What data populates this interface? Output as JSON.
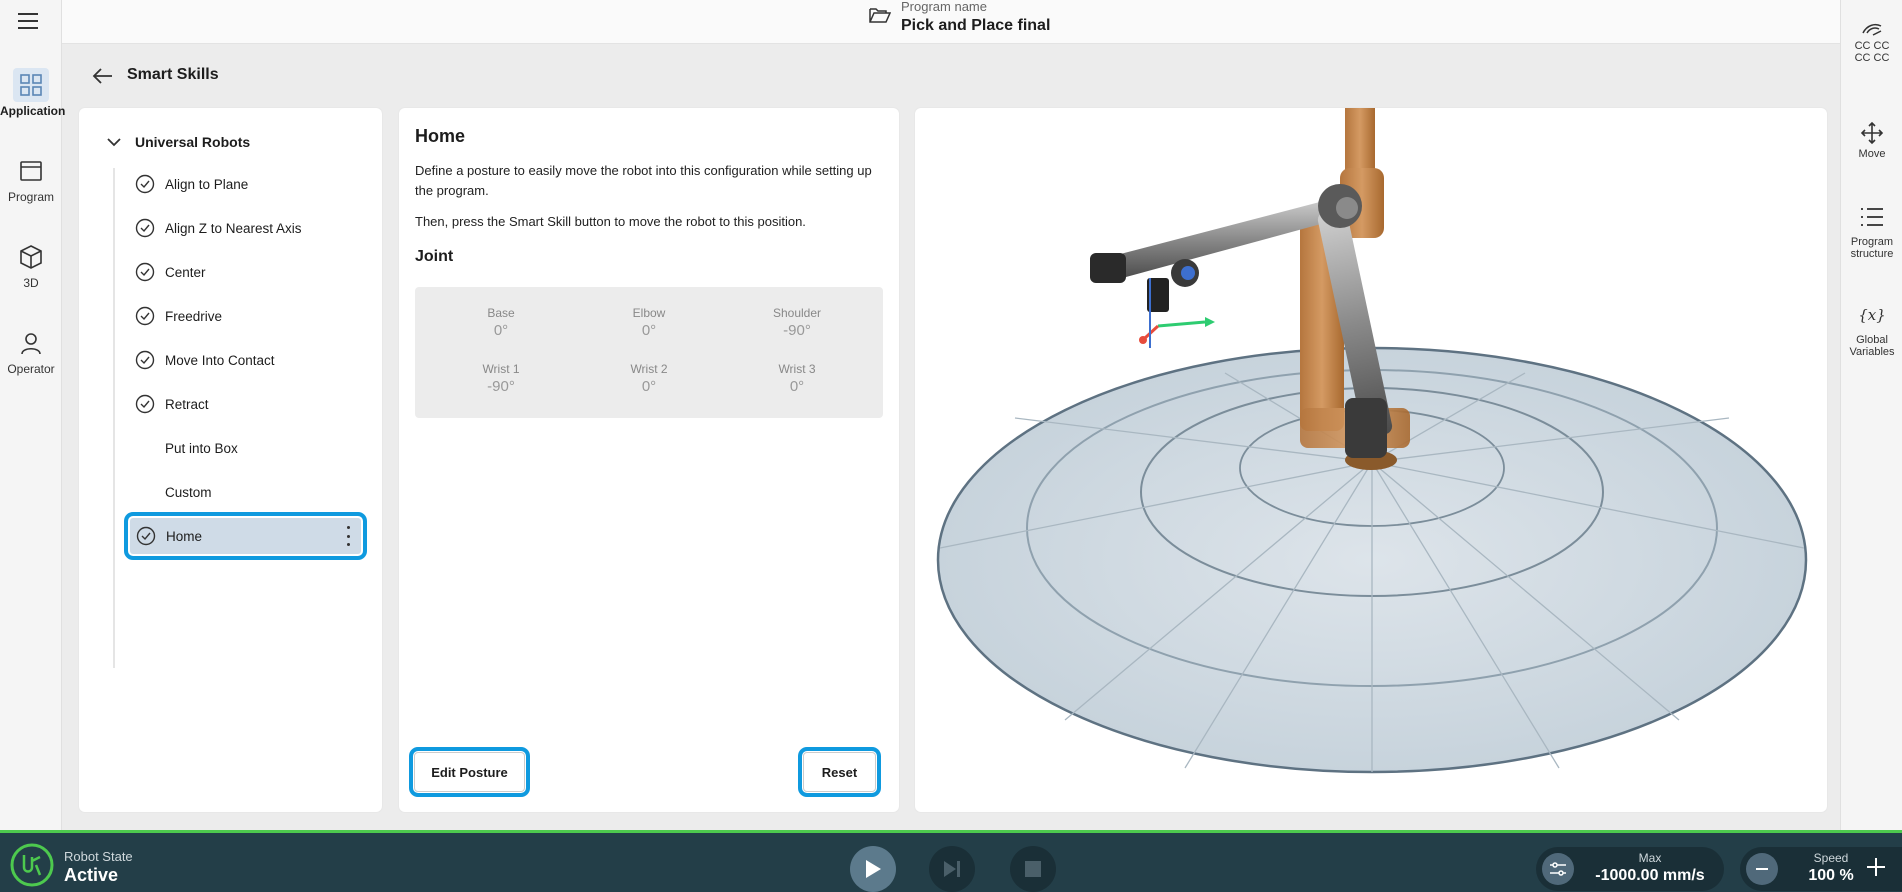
{
  "left_nav": {
    "items": [
      {
        "label": "Application",
        "icon": "grid-icon",
        "active": true
      },
      {
        "label": "Program",
        "icon": "program-window-icon",
        "active": false
      },
      {
        "label": "3D",
        "icon": "cube-icon",
        "active": false
      },
      {
        "label": "Operator",
        "icon": "person-icon",
        "active": false
      }
    ]
  },
  "right_nav": {
    "cc_lines": [
      "CC CC",
      "CC CC"
    ],
    "items": [
      {
        "label": "Move",
        "icon": "move-arrows-icon"
      },
      {
        "label_line1": "Program",
        "label_line2": "structure",
        "icon": "list-icon"
      },
      {
        "label_line1": "Global",
        "label_line2": "Variables",
        "icon": "variables-icon",
        "glyph": "{x}"
      }
    ]
  },
  "topbar": {
    "program_label": "Program name",
    "program_name": "Pick and Place final"
  },
  "page": {
    "title": "Smart Skills"
  },
  "tree": {
    "group_label": "Universal Robots",
    "items": [
      {
        "label": "Align to Plane",
        "checked": true
      },
      {
        "label": "Align Z to Nearest Axis",
        "checked": true
      },
      {
        "label": "Center",
        "checked": true
      },
      {
        "label": "Freedrive",
        "checked": true
      },
      {
        "label": "Move Into Contact",
        "checked": true
      },
      {
        "label": "Retract",
        "checked": true
      },
      {
        "label": "Put into Box",
        "checked": false
      },
      {
        "label": "Custom",
        "checked": false
      },
      {
        "label": "Home",
        "checked": true,
        "selected": true
      }
    ]
  },
  "detail": {
    "title": "Home",
    "description": "Define a posture to easily move the robot into this configuration while setting up the program.",
    "description2": "Then, press the Smart Skill button to move the robot to this position.",
    "joint_title": "Joint",
    "joints": [
      {
        "label": "Base",
        "value": "0°"
      },
      {
        "label": "Elbow",
        "value": "0°"
      },
      {
        "label": "Shoulder",
        "value": "-90°"
      },
      {
        "label": "Wrist 1",
        "value": "-90°"
      },
      {
        "label": "Wrist 2",
        "value": "0°"
      },
      {
        "label": "Wrist 3",
        "value": "0°"
      }
    ],
    "edit_button": "Edit Posture",
    "reset_button": "Reset"
  },
  "bottombar": {
    "robot_state_label": "Robot State",
    "robot_state_value": "Active",
    "max_label": "Max",
    "max_value": "-1000.00 mm/s",
    "speed_label": "Speed",
    "speed_value": "100 %",
    "status_color": "#4dc94e"
  }
}
